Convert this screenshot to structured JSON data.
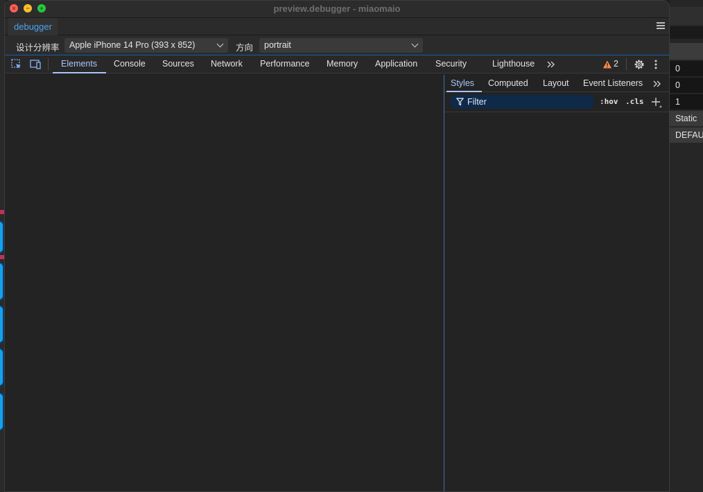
{
  "window": {
    "title": "preview.debugger - miaomaio"
  },
  "tabbar": {
    "tab": "debugger"
  },
  "settings": {
    "resolution_label": "设计分辨率",
    "resolution_value": "Apple iPhone 14 Pro (393 x 852)",
    "orientation_label": "方向",
    "orientation_value": "portrait"
  },
  "devtools": {
    "tabs": [
      "Elements",
      "Console",
      "Sources",
      "Network",
      "Performance",
      "Memory",
      "Application",
      "Security",
      "Lighthouse"
    ],
    "warning_count": "2"
  },
  "styles_pane": {
    "tabs": [
      "Styles",
      "Computed",
      "Layout",
      "Event Listeners"
    ],
    "filter_placeholder": "Filter",
    "hov": ":hov",
    "cls": ".cls"
  },
  "background_panel": {
    "values": [
      "0",
      "0",
      "1",
      "Static",
      "DEFAU"
    ]
  },
  "colors": {
    "accent": "#a8c7fa",
    "link_blue": "#4aa3f0",
    "warning": "#ff8c45"
  }
}
